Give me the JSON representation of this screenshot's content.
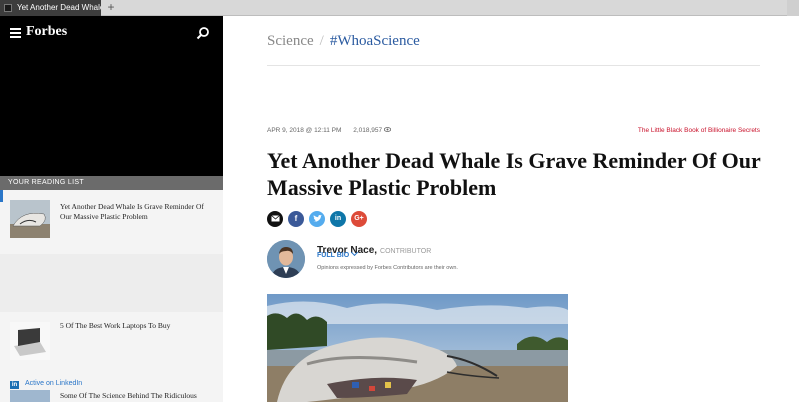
{
  "browser": {
    "tab_title": "Yet Another Dead Whale",
    "new_tab_symbol": "+"
  },
  "sidebar": {
    "brand": "Forbes",
    "reading_list_label": "YOUR READING LIST",
    "items": [
      {
        "title": "Yet Another Dead Whale Is Grave Reminder Of Our Massive Plastic Problem"
      },
      {
        "title": "5 Of The Best Work Laptops To Buy"
      },
      {
        "badge": "in",
        "badge_label": "Active on LinkedIn",
        "title": "Some Of The Science Behind The Ridiculous"
      }
    ]
  },
  "article": {
    "section": "Science",
    "separator": "/",
    "tag": "#WhoaScience",
    "date": "APR 9, 2018 @ 12:11 PM",
    "views": "2,018,957",
    "promo": "The Little Black Book of Billionaire Secrets",
    "headline": "Yet Another Dead Whale Is Grave Reminder Of Our Massive Plastic Problem",
    "share": {
      "email_icon": "email-icon",
      "facebook": "f",
      "twitter_icon": "twitter-icon",
      "linkedin": "in",
      "googleplus": "G+"
    },
    "author": {
      "name": "Trevor Nace,",
      "role": "CONTRIBUTOR",
      "full_bio": "FULL BIO",
      "disclaimer": "Opinions expressed by Forbes Contributors are their own."
    }
  },
  "colors": {
    "accent_blue": "#2a76c8",
    "promo_red": "#c9102a",
    "sidebar_black": "#000000"
  }
}
